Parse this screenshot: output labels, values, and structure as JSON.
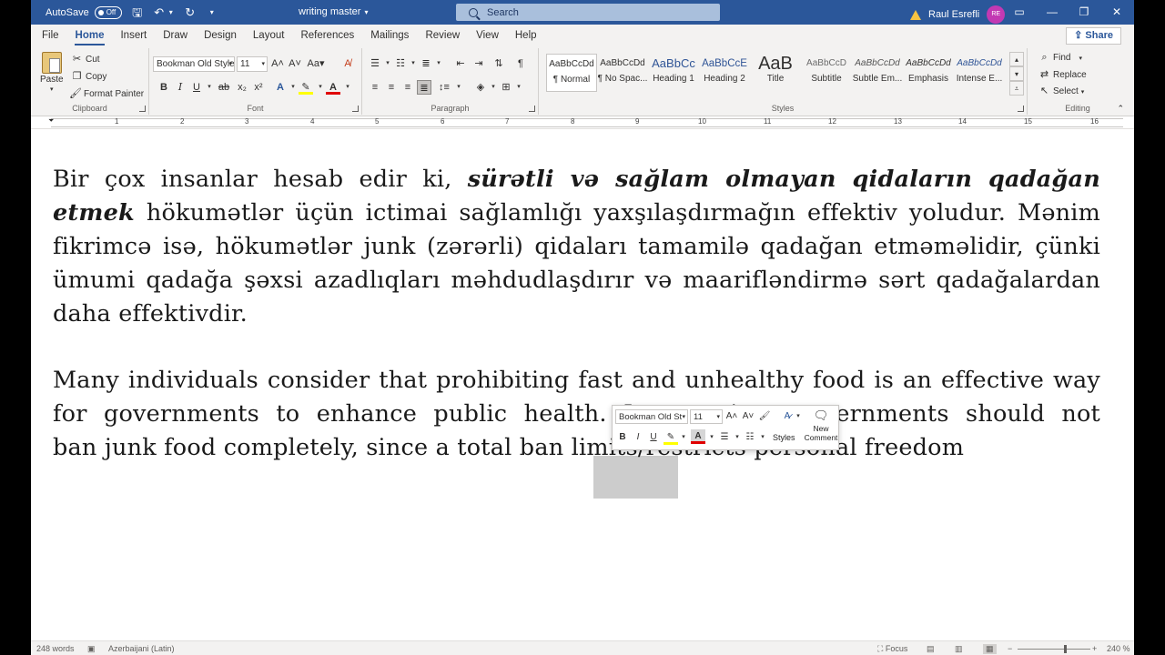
{
  "titlebar": {
    "autosave_label": "AutoSave",
    "autosave_state": "Off",
    "doc_title": "writing master",
    "search_placeholder": "Search",
    "user_name": "Raul Esrefli",
    "user_initials": "RE"
  },
  "menu": {
    "tabs": [
      "File",
      "Home",
      "Insert",
      "Draw",
      "Design",
      "Layout",
      "References",
      "Mailings",
      "Review",
      "View",
      "Help"
    ],
    "active": "Home",
    "share_label": "Share"
  },
  "ribbon": {
    "clipboard": {
      "paste": "Paste",
      "cut": "Cut",
      "copy": "Copy",
      "format_painter": "Format Painter",
      "label": "Clipboard"
    },
    "font": {
      "font_name": "Bookman Old Style",
      "font_size": "11",
      "label": "Font",
      "case_label": "Aa"
    },
    "paragraph": {
      "label": "Paragraph"
    },
    "styles": {
      "label": "Styles",
      "items": [
        {
          "sample": "AaBbCcDd",
          "name": "¶ Normal"
        },
        {
          "sample": "AaBbCcDd",
          "name": "¶ No Spac..."
        },
        {
          "sample": "AaBbCc",
          "name": "Heading 1"
        },
        {
          "sample": "AaBbCcE",
          "name": "Heading 2"
        },
        {
          "sample": "AaB",
          "name": "Title"
        },
        {
          "sample": "AaBbCcD",
          "name": "Subtitle"
        },
        {
          "sample": "AaBbCcDd",
          "name": "Subtle Em..."
        },
        {
          "sample": "AaBbCcDd",
          "name": "Emphasis"
        },
        {
          "sample": "AaBbCcDd",
          "name": "Intense E..."
        }
      ]
    },
    "editing": {
      "find": "Find",
      "replace": "Replace",
      "select": "Select",
      "label": "Editing"
    }
  },
  "ruler": {
    "numbers": [
      "1",
      "2",
      "3",
      "4",
      "5",
      "6",
      "7",
      "8",
      "9",
      "10",
      "11",
      "12",
      "13",
      "14",
      "15",
      "16"
    ]
  },
  "document": {
    "p1_a": "Bir çox insanlar hesab edir ki, ",
    "p1_b": "sürətli və sağlam olmayan qidaların qadağan etmek",
    "p1_c": " hökumətlər üçün ictimai sağlamlığı yaxşılaşdırmağın effektiv yoludur. Mənim fikrimcə isə, hökumətlər junk (zərərli) qidaları tamamilə qadağan etməməlidir, çünki ümumi qadağa şəxsi azadlıqları məhdudlaşdırır və maarifləndirmə sərt qadağalardan daha effektivdir.",
    "p2_line1": "Many individuals consider that prohibiting fast and unhealthy food is an effective way for governments to enhance public health. In my view, governments should not",
    "p2_line2": "ban junk food completely, since a total ban limits/restricts personal freedom"
  },
  "mini_toolbar": {
    "font_name": "Bookman Old St",
    "font_size": "11",
    "styles_label": "Styles",
    "new_comment_l1": "New",
    "new_comment_l2": "Comment"
  },
  "statusbar": {
    "words": "248 words",
    "language": "Azerbaijani (Latin)",
    "focus": "Focus",
    "zoom": "240 %"
  },
  "colors": {
    "title_bar": "#2b579a",
    "ribbon_bg": "#f3f2f1",
    "highlight_yellow": "#ffff00",
    "font_red": "#e00000",
    "avatar": "#c239b3"
  }
}
